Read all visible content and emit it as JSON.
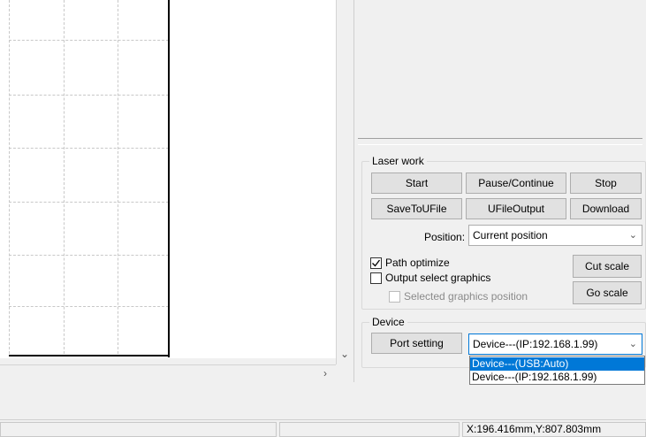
{
  "laser_work": {
    "title": "Laser work",
    "start": "Start",
    "pause_continue": "Pause/Continue",
    "stop": "Stop",
    "save_to_ufile": "SaveToUFile",
    "ufile_output": "UFileOutput",
    "download": "Download",
    "position_label": "Position:",
    "position_value": "Current position",
    "path_optimize": "Path optimize",
    "output_select_graphics": "Output select graphics",
    "selected_graphics_position": "Selected graphics position",
    "cut_scale": "Cut scale",
    "go_scale": "Go scale",
    "path_optimize_checked": true,
    "output_select_checked": false,
    "selected_pos_checked": false
  },
  "device": {
    "title": "Device",
    "port_setting": "Port setting",
    "selected": "Device---(IP:192.168.1.99)",
    "options": [
      "Device---(USB:Auto)",
      "Device---(IP:192.168.1.99)"
    ]
  },
  "statusbar": {
    "coords": "X:196.416mm,Y:807.803mm"
  },
  "icons": {
    "scroll_down": "chevron-down-icon",
    "scroll_right": "chevron-right-icon",
    "combo_caret": "chevron-down-icon"
  }
}
